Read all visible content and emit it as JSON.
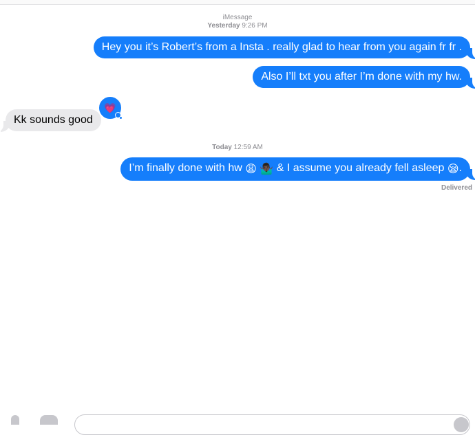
{
  "thread": {
    "service_label": "iMessage",
    "first_day": "Yesterday",
    "first_time": "9:26 PM",
    "second_day": "Today",
    "second_time": "12:59 AM"
  },
  "messages": [
    {
      "text": "Hey you it’s Robert’s from a Insta . really glad to hear from you again fr fr ."
    },
    {
      "text": "Also I’ll txt you after I’m done with my hw."
    },
    {
      "text": "Kk sounds good"
    },
    {
      "part1": "I’m finally done with hw ",
      "emoji1": "😩",
      "emoji2": "🤷🏿‍♂️",
      "part2": " & I assume you already fell asleep ",
      "emoji3": "😪",
      "part3": "."
    }
  ],
  "tapback": {
    "icon": "heart-icon",
    "emoji": "💗"
  },
  "status": {
    "delivered": "Delivered"
  },
  "colors": {
    "sent": "#157efb",
    "received": "#e9e9eb",
    "meta": "#8e8e93"
  }
}
